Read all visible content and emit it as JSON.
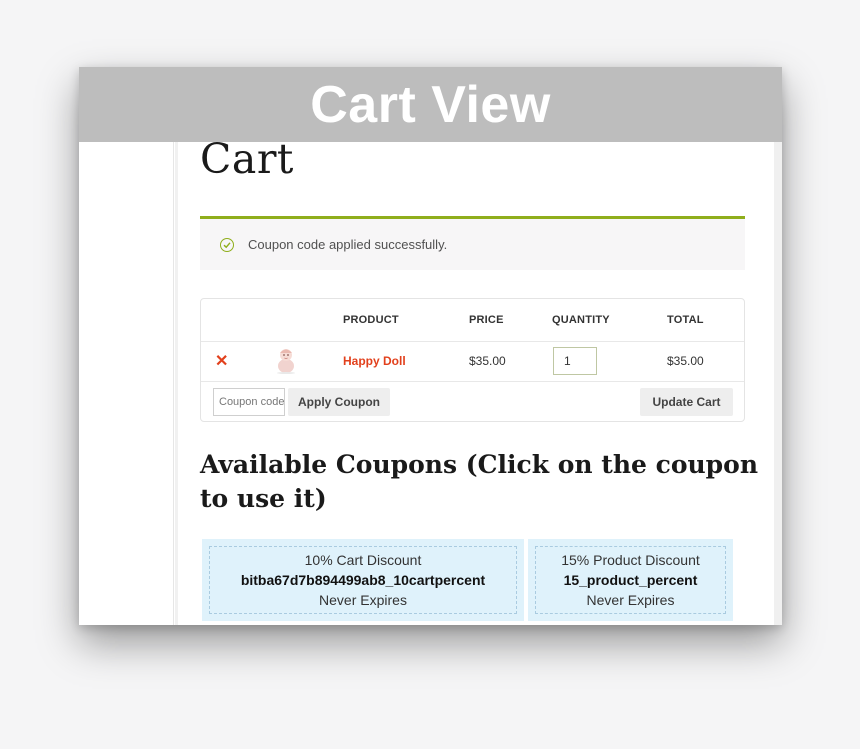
{
  "banner": {
    "title": "Cart View"
  },
  "page": {
    "title": "Cart"
  },
  "notice": {
    "text": "Coupon code applied successfully.",
    "icon": "check-circle-icon",
    "accent_color": "#8fae1b"
  },
  "cart_table": {
    "headers": {
      "product": "PRODUCT",
      "price": "PRICE",
      "quantity": "QUANTITY",
      "total": "TOTAL"
    },
    "rows": [
      {
        "product": "Happy Doll",
        "price": "$35.00",
        "quantity": "1",
        "total": "$35.00",
        "thumbnail_icon": "doll-icon"
      }
    ],
    "coupon_placeholder": "Coupon code",
    "apply_coupon_label": "Apply Coupon",
    "update_cart_label": "Update Cart",
    "remove_icon": "close-icon",
    "link_color": "#e2401c"
  },
  "coupons": {
    "heading": "Available Coupons (Click on the coupon to use it)",
    "items": [
      {
        "title": "10% Cart Discount",
        "code": "bitba67d7b894499ab8_10cartpercent",
        "expiry": "Never Expires"
      },
      {
        "title": "15% Product Discount",
        "code": "15_product_percent",
        "expiry": "Never Expires"
      }
    ],
    "card_color": "#dff2fb"
  }
}
